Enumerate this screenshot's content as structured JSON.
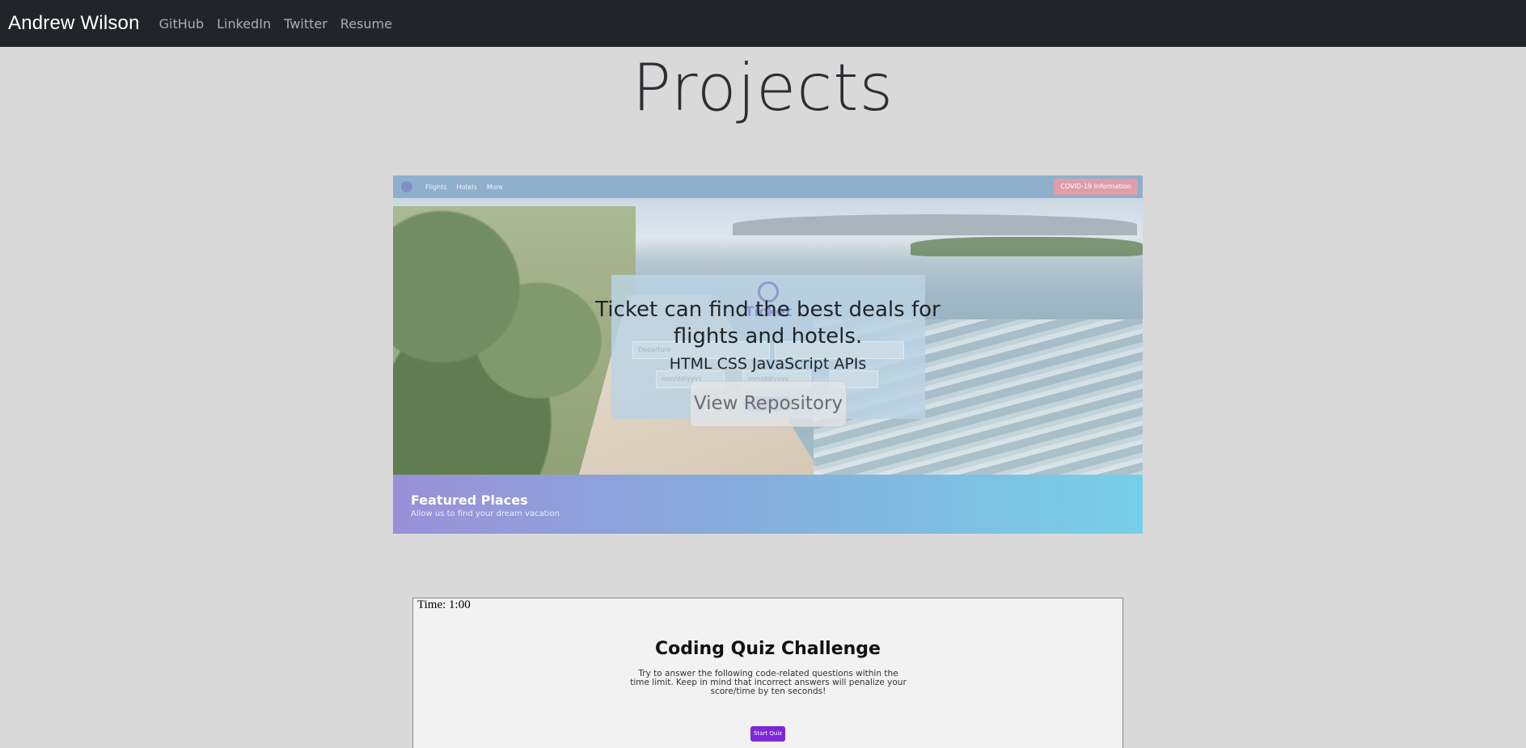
{
  "navbar": {
    "brand": "Andrew Wilson",
    "links": [
      {
        "label": "GitHub"
      },
      {
        "label": "LinkedIn"
      },
      {
        "label": "Twitter"
      },
      {
        "label": "Resume"
      }
    ]
  },
  "page_title": "Projects",
  "projects": [
    {
      "screenshot": {
        "nav_items": [
          "Flights",
          "Hotels",
          "More"
        ],
        "alert_button": "COVID-19 Information",
        "search_title": "Ticket",
        "field_placeholder": "Departure",
        "date_placeholder": "mm/dd/yyyy",
        "band_title": "Featured Places",
        "band_subtitle": "Allow us to find your dream vacation"
      },
      "description": "Ticket can find the best deals for flights and hotels.",
      "technologies": "HTML CSS JavaScript APIs",
      "repo_button": "View Repository"
    },
    {
      "screenshot": {
        "timer": "Time: 1:00",
        "title": "Coding Quiz Challenge",
        "subtitle": "Try to answer the following code-related questions within the time limit. Keep in mind that incorrect answers will penalize your score/time by ten seconds!",
        "start_button": "Start Quiz"
      }
    }
  ],
  "colors": {
    "navbar_bg": "#212529",
    "page_bg": "#d9d9d9",
    "quiz_button": "#7f27d8"
  }
}
